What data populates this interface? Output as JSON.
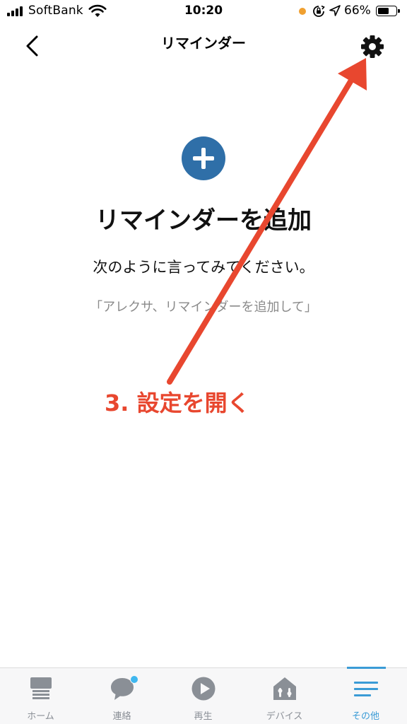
{
  "status_bar": {
    "carrier": "SoftBank",
    "time": "10:20",
    "battery_percent": "66%",
    "battery_level": 0.66
  },
  "nav": {
    "title": "リマインダー",
    "back_icon": "chevron-left-icon",
    "settings_icon": "gear-icon"
  },
  "main": {
    "add_icon": "plus-circle-icon",
    "add_icon_color": "#2f6fa8",
    "heading": "リマインダーを追加",
    "instruction": "次のように言ってみてください。",
    "example": "「アレクサ、リマインダーを追加して」"
  },
  "annotation": {
    "text": "3. 設定を開く",
    "color": "#e8472f"
  },
  "tabs": [
    {
      "label": "ホーム",
      "icon": "home-icon",
      "active": false
    },
    {
      "label": "連絡",
      "icon": "chat-bubble-icon",
      "active": false,
      "badge": true
    },
    {
      "label": "再生",
      "icon": "play-icon",
      "active": false
    },
    {
      "label": "デバイス",
      "icon": "devices-home-icon",
      "active": false
    },
    {
      "label": "その他",
      "icon": "menu-icon",
      "active": true
    }
  ],
  "colors": {
    "accent": "#3a9bd6",
    "inactive_tab": "#8a8f96"
  }
}
